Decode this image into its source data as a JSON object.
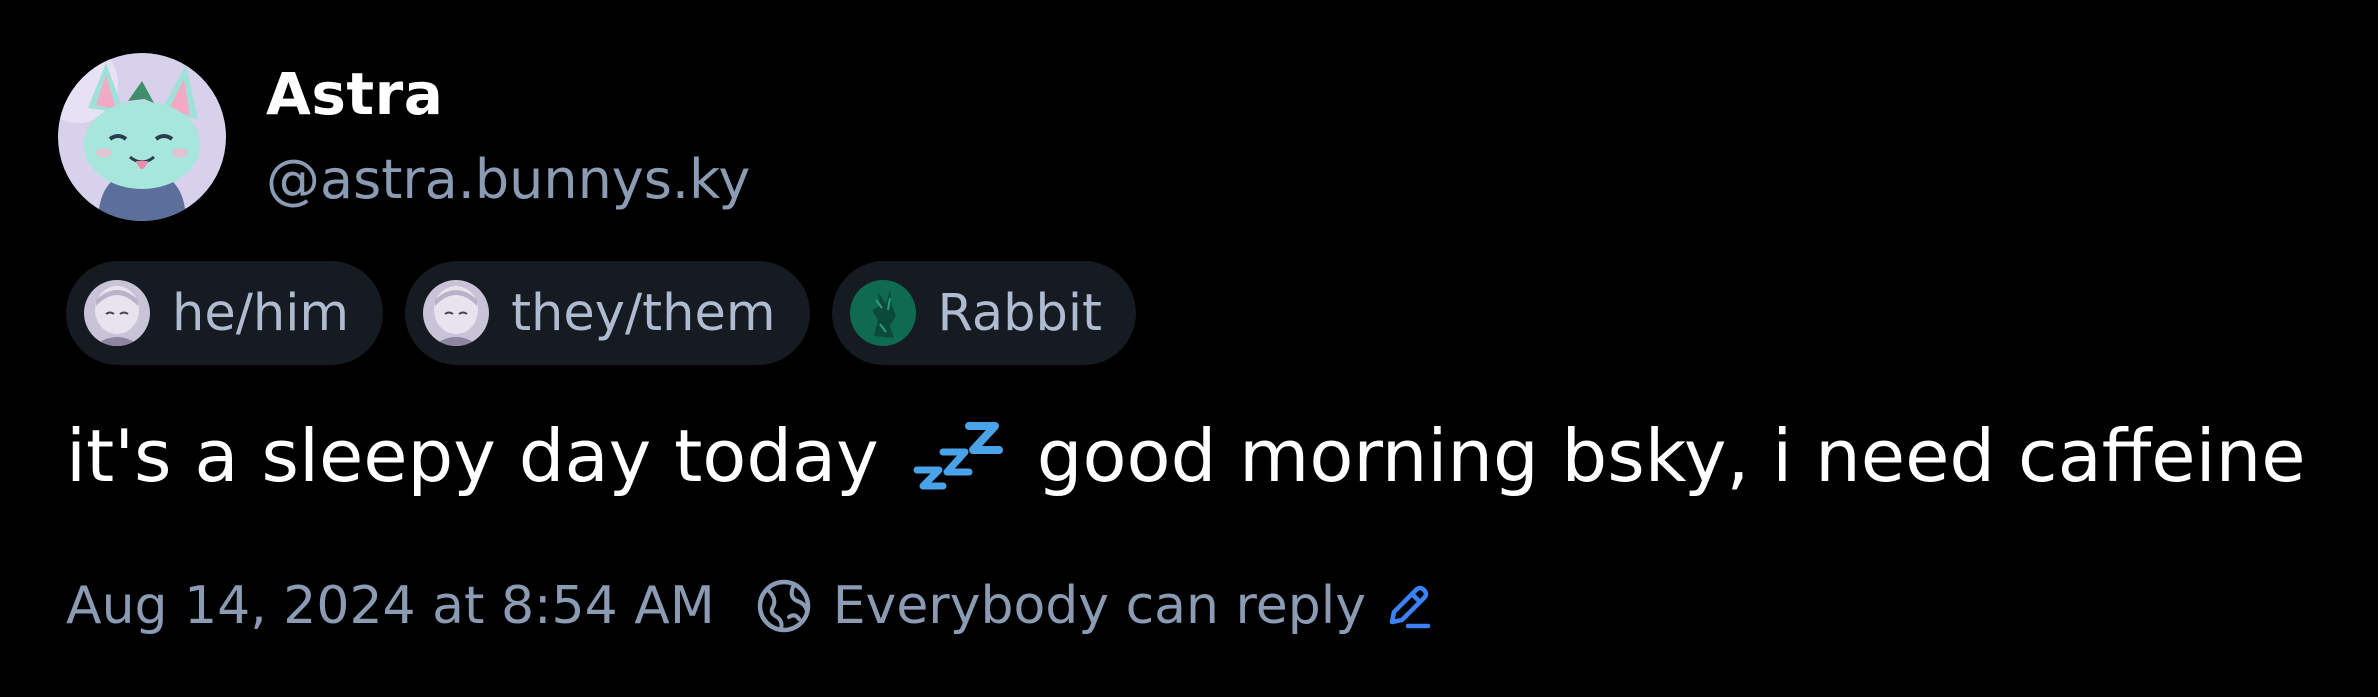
{
  "author": {
    "display_name": "Astra",
    "handle": "@astra.bunnys.ky",
    "avatar_icon": "avatar-image"
  },
  "badges": [
    {
      "label": "he/him",
      "icon": "avatar-thumbnail"
    },
    {
      "label": "they/them",
      "icon": "avatar-thumbnail"
    },
    {
      "label": "Rabbit",
      "icon": "rabbit-thumbnail"
    }
  ],
  "post": {
    "text_before": "it's a sleepy day today",
    "emoji": "zzz-icon",
    "text_after": "good morning bsky, i need caffeine"
  },
  "meta": {
    "timestamp": "Aug 14, 2024 at 8:54 AM",
    "reply_setting": "Everybody can reply"
  },
  "colors": {
    "background": "#000000",
    "text_primary": "#ffffff",
    "text_secondary": "#8b9bb4",
    "badge_bg": "#161b22",
    "accent": "#3b82f6"
  }
}
